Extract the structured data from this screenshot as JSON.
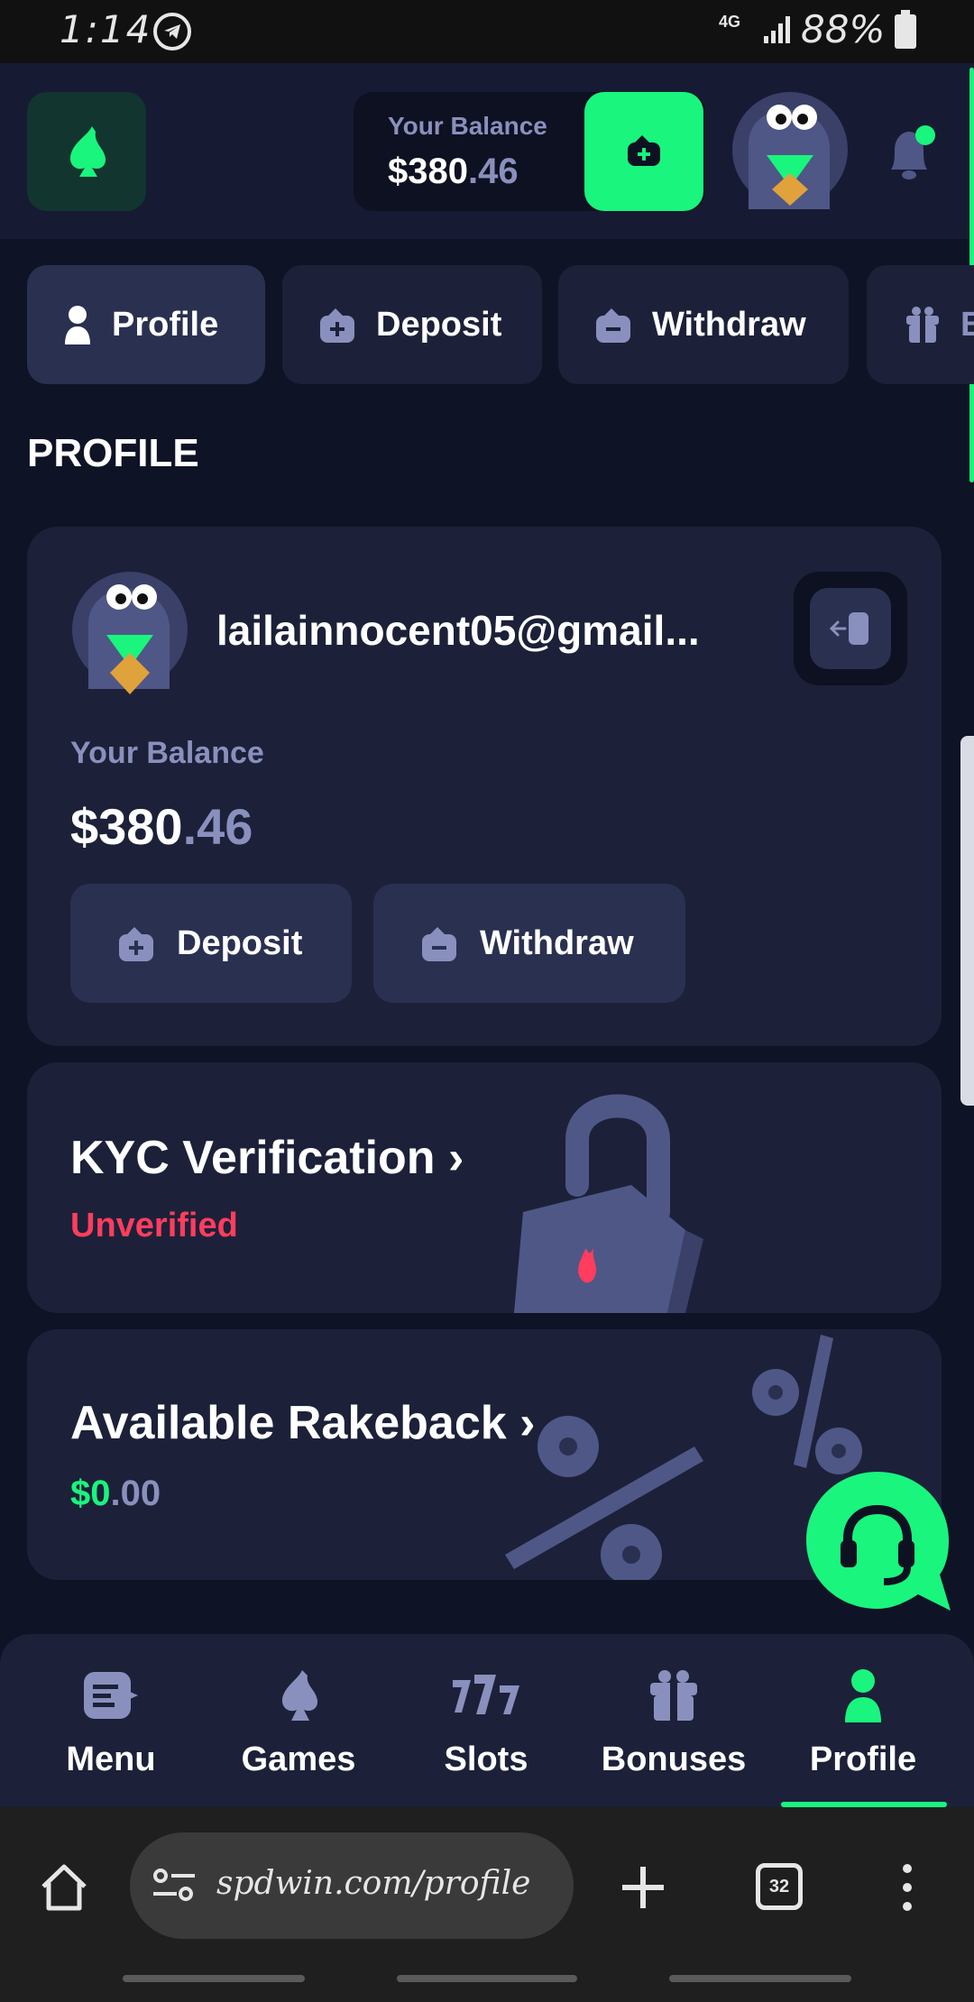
{
  "status_bar": {
    "time": "1:14",
    "network": "4G",
    "battery": "88%"
  },
  "header": {
    "balance_label": "Your Balance",
    "balance_main": "$380",
    "balance_cents": ".46"
  },
  "tabs": [
    {
      "label": "Profile",
      "icon": "user-icon",
      "active": true
    },
    {
      "label": "Deposit",
      "icon": "wallet-plus-icon"
    },
    {
      "label": "Withdraw",
      "icon": "wallet-minus-icon"
    },
    {
      "label": "B",
      "icon": "gift-icon"
    }
  ],
  "page_title": "PROFILE",
  "profile_card": {
    "email": "lailainnocent05@gmail...",
    "balance_label": "Your Balance",
    "balance_main": "$380",
    "balance_cents": ".46",
    "deposit_label": "Deposit",
    "withdraw_label": "Withdraw"
  },
  "kyc": {
    "title": "KYC Verification",
    "chevron": "›",
    "status": "Unverified"
  },
  "rakeback": {
    "title": "Available Rakeback",
    "chevron": "›",
    "value_main": "$0",
    "value_cents": ".00"
  },
  "bottom_nav": [
    {
      "label": "Menu",
      "icon": "menu-icon"
    },
    {
      "label": "Games",
      "icon": "spade-icon"
    },
    {
      "label": "Slots",
      "icon": "slots-777-icon"
    },
    {
      "label": "Bonuses",
      "icon": "gift-icon"
    },
    {
      "label": "Profile",
      "icon": "user-icon",
      "active": true
    }
  ],
  "browser": {
    "url": "spdwin.com/profile",
    "tab_count": "32"
  },
  "colors": {
    "accent": "#19f57d",
    "background": "#0f1326",
    "card": "#1c2139",
    "muted": "#8a90bd",
    "danger": "#ff3d5e"
  }
}
